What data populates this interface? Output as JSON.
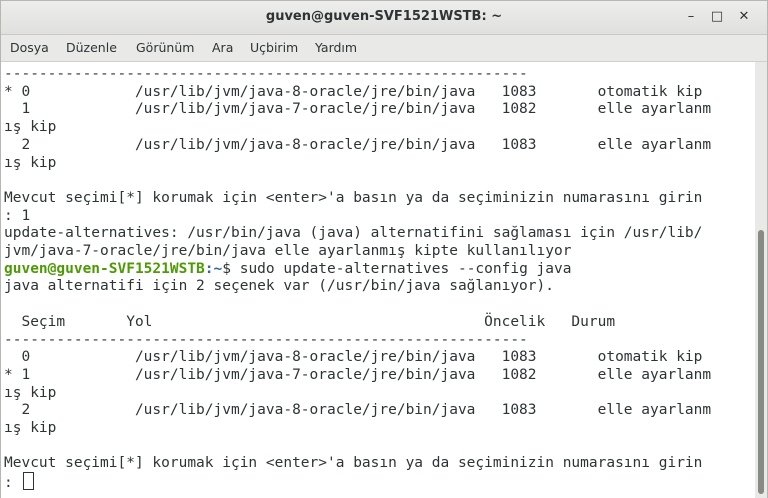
{
  "window": {
    "title": "guven@guven-SVF1521WSTB: ~",
    "buttons": {
      "minimize": "–",
      "maximize": "□",
      "close": "✕"
    }
  },
  "menubar": {
    "items": [
      {
        "label": "Dosya"
      },
      {
        "label": "Düzenle"
      },
      {
        "label": "Görünüm"
      },
      {
        "label": "Ara"
      },
      {
        "label": "Uçbirim"
      },
      {
        "label": "Yardım"
      }
    ]
  },
  "terminal": {
    "lines": [
      "------------------------------------------------------------",
      "* 0            /usr/lib/jvm/java-8-oracle/jre/bin/java   1083       otomatik kip",
      "  1            /usr/lib/jvm/java-7-oracle/jre/bin/java   1082       elle ayarlanm",
      "ış kip",
      "  2            /usr/lib/jvm/java-8-oracle/jre/bin/java   1083       elle ayarlanm",
      "ış kip",
      "",
      "Mevcut seçimi[*] korumak için <enter>'a basın ya da seçiminizin numarasını girin",
      ": 1",
      "update-alternatives: /usr/bin/java (java) alternatifini sağlaması için /usr/lib/",
      "jvm/java-7-oracle/jre/bin/java elle ayarlanmış kipte kullanılıyor",
      "__PROMPT__",
      "java alternatifi için 2 seçenek var (/usr/bin/java sağlanıyor).",
      "",
      "  Seçim       Yol                                      Öncelik   Durum",
      "------------------------------------------------------------",
      "  0            /usr/lib/jvm/java-8-oracle/jre/bin/java   1083       otomatik kip",
      "* 1            /usr/lib/jvm/java-7-oracle/jre/bin/java   1082       elle ayarlanm",
      "ış kip",
      "  2            /usr/lib/jvm/java-8-oracle/jre/bin/java   1083       elle ayarlanm",
      "ış kip",
      "",
      "Mevcut seçimi[*] korumak için <enter>'a basın ya da seçiminizin numarasını girin",
      "__INPUT__"
    ],
    "prompt": {
      "user_host": "guven@guven-SVF1521WSTB",
      "path": ":~",
      "command": "$ sudo update-alternatives --config java"
    },
    "input_prefix": ": "
  }
}
